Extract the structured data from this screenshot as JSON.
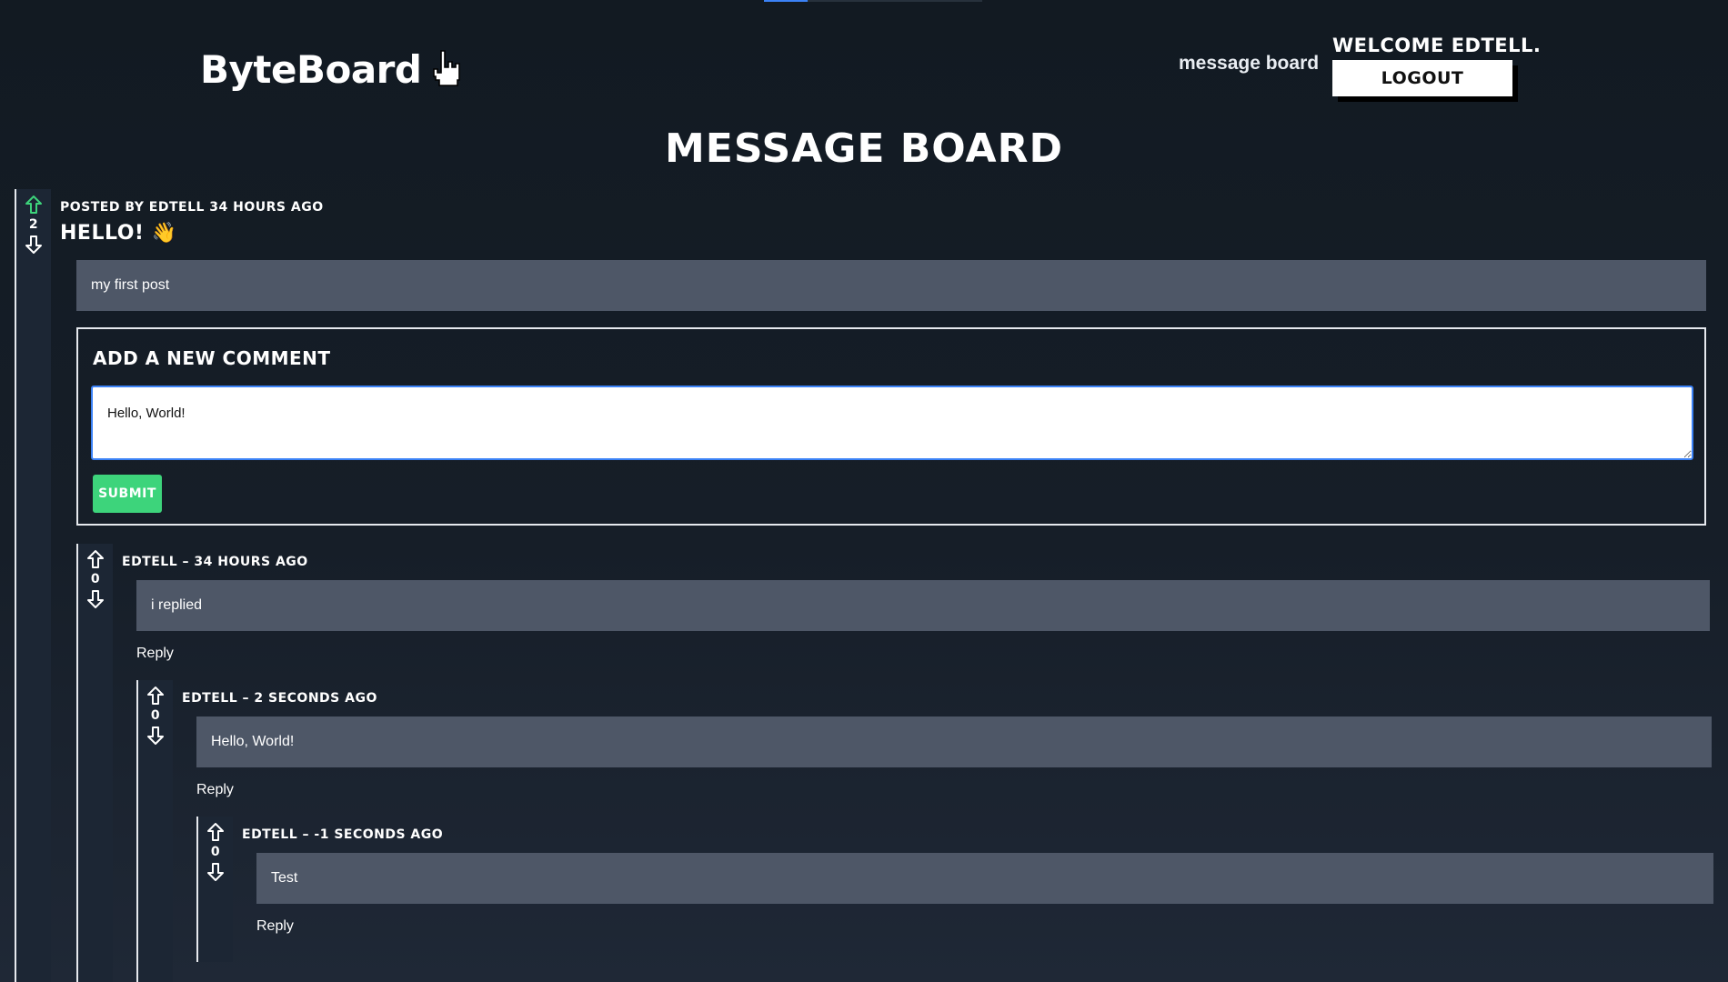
{
  "header": {
    "brand": "ByteBoard",
    "brand_icon": "pointer-hand-icon",
    "nav_link": "message board",
    "welcome": "WELCOME EDTELL.",
    "logout_label": "LOGOUT"
  },
  "page_title": "MESSAGE BOARD",
  "post": {
    "meta": "POSTED BY EDTELL 34 HOURS AGO",
    "title": "HELLO!",
    "title_emoji": "👋",
    "body": "my first post",
    "votes": "2",
    "vote_state": "upvoted"
  },
  "comment_form": {
    "title": "ADD A NEW COMMENT",
    "input_value": "Hello, World!",
    "submit_label": "SUBMIT"
  },
  "comments": [
    {
      "meta": "EDTELL – 34 HOURS AGO",
      "body": "i replied",
      "votes": "0",
      "reply_label": "Reply"
    },
    {
      "meta": "EDTELL – 2 SECONDS AGO",
      "body": "Hello, World!",
      "votes": "0",
      "reply_label": "Reply"
    },
    {
      "meta": "EDTELL – -1 SECONDS AGO",
      "body": "Test",
      "votes": "0",
      "reply_label": "Reply"
    }
  ],
  "colors": {
    "background": "#161e28",
    "content_box": "#4e5767",
    "vote_rail": "#1c2634",
    "submit": "#3dd47b",
    "upvote_active": "#3dd47b",
    "focus": "#3b82f6"
  }
}
